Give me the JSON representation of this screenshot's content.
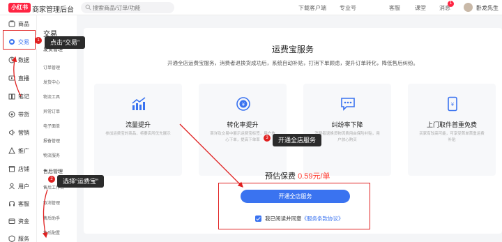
{
  "header": {
    "logo": "小红书",
    "app_title": "商家管理后台",
    "search_placeholder": "搜索商品/订单/功能",
    "links": [
      "下载客户端",
      "专业号",
      "客服",
      "课堂",
      "消息"
    ],
    "message_count": "1",
    "user_name": "卧龙先生"
  },
  "sidebar": {
    "items": [
      {
        "label": "商品",
        "icon": "product-icon"
      },
      {
        "label": "交易",
        "icon": "trade-icon",
        "active": true
      },
      {
        "label": "数据",
        "icon": "data-icon"
      },
      {
        "label": "直播",
        "icon": "live-icon"
      },
      {
        "label": "笔记",
        "icon": "note-icon"
      },
      {
        "label": "带货",
        "icon": "promote-icon"
      },
      {
        "label": "营销",
        "icon": "marketing-icon"
      },
      {
        "label": "推广",
        "icon": "ads-icon"
      },
      {
        "label": "店铺",
        "icon": "shop-icon"
      },
      {
        "label": "用户",
        "icon": "user-icon"
      },
      {
        "label": "客服",
        "icon": "service-icon"
      },
      {
        "label": "资金",
        "icon": "fund-icon"
      },
      {
        "label": "服务",
        "icon": "services-icon"
      }
    ]
  },
  "submenu": {
    "title": "交易",
    "groups": [
      {
        "label": "发货管理",
        "items": [
          "订单管理",
          "发货中心",
          "物流工具",
          "异常订单",
          "电子面单",
          "报备管理",
          "物流服务"
        ]
      },
      {
        "label": "售后管理",
        "items": [
          "售后工作台",
          "取消管理",
          "售后助手",
          "售后配置"
        ]
      }
    ]
  },
  "main": {
    "title": "运费宝服务",
    "subtitle": "开通全店运费宝服务，消费者退换货成功后，系统自动补贴，打消下单顾虑，提升订单转化，降低售后纠纷。",
    "cards": [
      {
        "title": "流量提升",
        "desc": "参加运费宝的商品，将要店所优先展示",
        "icon": "traffic-chart-icon"
      },
      {
        "title": "转化率提升",
        "desc": "商详及交易中展示运费宝标签，用户放心下单，提高下单率",
        "icon": "conversion-coin-icon"
      },
      {
        "title": "纠纷率下降",
        "desc": "消费者退换货物流费用由保险补贴，用户放心购买",
        "icon": "dispute-chat-icon"
      },
      {
        "title": "上门取件首重免费",
        "desc": "买家有较高可能，可享受首单首重运费补贴",
        "icon": "pickup-phone-icon"
      }
    ],
    "fee_label": "预估保费",
    "fee_value": "0.59元/单",
    "open_button": "开通全店服务",
    "agree_prefix": "我已阅读并同意",
    "agree_link": "《服务条款协议》"
  },
  "annotations": [
    {
      "num": "1",
      "text": "点击“交易”"
    },
    {
      "num": "2",
      "text": "选择“运费宝”"
    },
    {
      "num": "3",
      "text": "开通全店服务"
    }
  ],
  "colors": {
    "accent": "#3a73f0",
    "brand": "#ff2442",
    "price": "#ff3b30",
    "annotation": "#e02020"
  }
}
